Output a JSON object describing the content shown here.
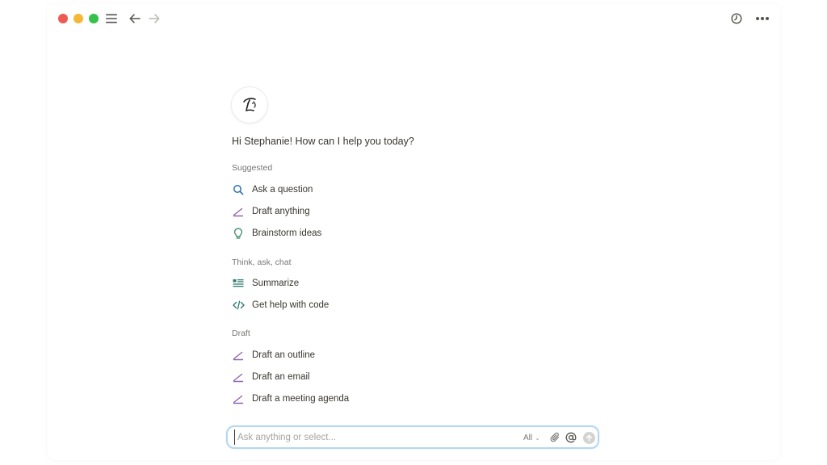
{
  "titlebar": {
    "icons": [
      "menu-icon",
      "back-arrow-icon",
      "forward-arrow-icon",
      "history-icon",
      "more-options-icon"
    ]
  },
  "greeting": "Hi Stephanie! How can I help you today?",
  "sections": [
    {
      "label": "Suggested",
      "items": [
        {
          "label": "Ask a question",
          "icon": "search-icon"
        },
        {
          "label": "Draft anything",
          "icon": "pen-icon"
        },
        {
          "label": "Brainstorm ideas",
          "icon": "lightbulb-icon"
        }
      ]
    },
    {
      "label": "Think, ask, chat",
      "items": [
        {
          "label": "Summarize",
          "icon": "summarize-icon"
        },
        {
          "label": "Get help with code",
          "icon": "code-icon"
        }
      ]
    },
    {
      "label": "Draft",
      "items": [
        {
          "label": "Draft an outline",
          "icon": "pen-icon"
        },
        {
          "label": "Draft an email",
          "icon": "pen-icon"
        },
        {
          "label": "Draft a meeting agenda",
          "icon": "pen-icon"
        }
      ]
    }
  ],
  "input": {
    "placeholder": "Ask anything or select...",
    "value": "",
    "scope": "All",
    "icons": [
      "paperclip-icon",
      "at-sign-icon",
      "send-arrow-icon"
    ]
  },
  "colors": {
    "traffic_red": "#ee5a52",
    "traffic_yellow": "#f5b836",
    "traffic_green": "#34c24a",
    "pen_accent": "#9065b0",
    "search_accent": "#2a6fb0",
    "code_accent": "#2f7a6e",
    "input_border": "#b4d7f0"
  }
}
